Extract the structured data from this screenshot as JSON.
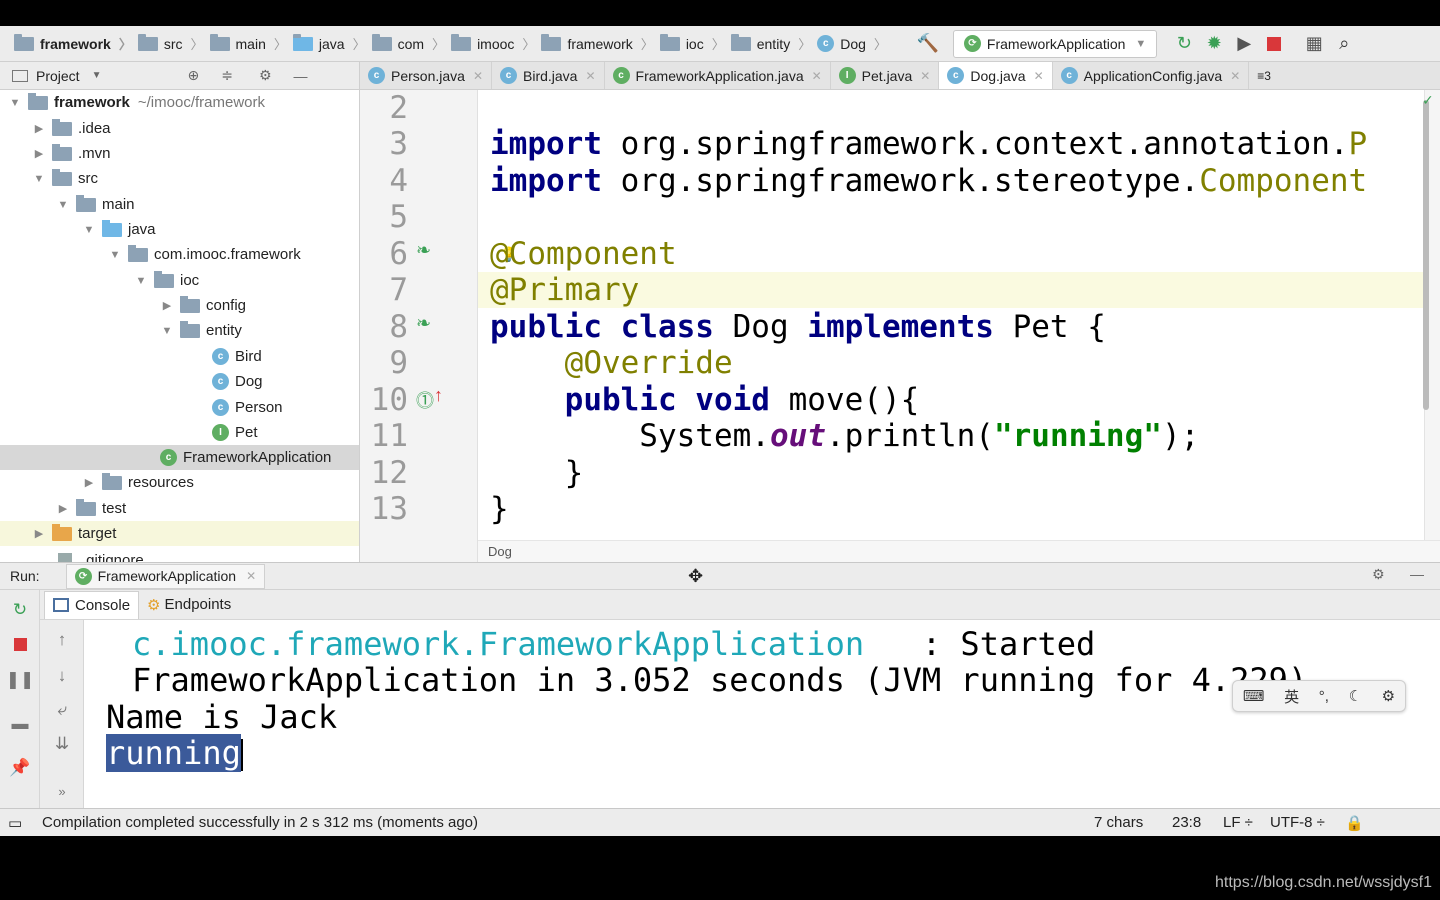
{
  "breadcrumb": [
    "framework",
    "src",
    "main",
    "java",
    "com",
    "imooc",
    "framework",
    "ioc",
    "entity",
    "Dog"
  ],
  "run_config": "FrameworkApplication",
  "project_panel": {
    "title": "Project"
  },
  "tabs": [
    {
      "label": "Person.java",
      "icon": "C"
    },
    {
      "label": "Bird.java",
      "icon": "C"
    },
    {
      "label": "FrameworkApplication.java",
      "icon": "C"
    },
    {
      "label": "Pet.java",
      "icon": "I"
    },
    {
      "label": "Dog.java",
      "icon": "C"
    },
    {
      "label": "ApplicationConfig.java",
      "icon": "C"
    },
    {
      "label": "≡3",
      "icon": ""
    }
  ],
  "tree": {
    "root": "framework",
    "root_path": "~/imooc/framework",
    "items": [
      ".idea",
      ".mvn",
      "src",
      "main",
      "java",
      "com.imooc.framework",
      "ioc",
      "config",
      "entity",
      "Bird",
      "Dog",
      "Person",
      "Pet",
      "FrameworkApplication",
      "resources",
      "test",
      "target",
      ".gitignore"
    ]
  },
  "code": {
    "line_numbers": [
      "2",
      "3",
      "4",
      "5",
      "6",
      "7",
      "8",
      "9",
      "10",
      "11",
      "12",
      "13"
    ],
    "import_kw": "import",
    "import1_path": " org.springframework.context.annotation.",
    "import1_cls": "P",
    "import2_path": " org.springframework.stereotype.",
    "import2_cls": "Component",
    "ann_component": "@Component",
    "ann_primary": "@Primary",
    "l8_kw1": "public class",
    "l8_name": " Dog ",
    "l8_kw2": "implements",
    "l8_rest": " Pet {",
    "l9": "    @Override",
    "l10_kw": "    public void",
    "l10_rest": " move(){",
    "l11_a": "        System.",
    "l11_out": "out",
    "l11_b": ".println(",
    "l11_str": "\"running\"",
    "l11_c": ");",
    "l12": "    }",
    "l13": "}",
    "crumb": "Dog"
  },
  "run": {
    "label": "Run:",
    "config_tab": "FrameworkApplication",
    "console_tab": "Console",
    "endpoints_tab": "Endpoints"
  },
  "console": {
    "line1_cls": "c.imooc.framework.FrameworkApplication",
    "line1_rest": "   : Started",
    "line2": "FrameworkApplication in 3.052 seconds (JVM running for 4.229)",
    "line3": "Name is Jack",
    "line4": "running"
  },
  "ime": {
    "lang": "英"
  },
  "status": {
    "message": "Compilation completed successfully in 2 s 312 ms (moments ago)",
    "chars": "7 chars",
    "position": "23:8",
    "line_sep": "LF ÷",
    "encoding": "UTF-8 ÷"
  },
  "watermark": "https://blog.csdn.net/wssjdysf1"
}
